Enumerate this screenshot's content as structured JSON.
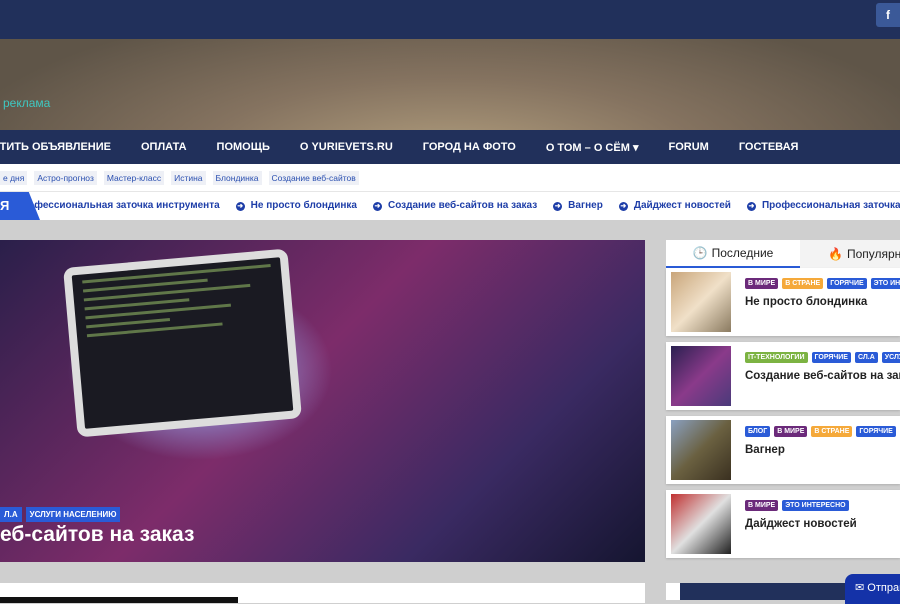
{
  "topbar": {
    "social": "f"
  },
  "header": {
    "ad_text": "реклама"
  },
  "nav": [
    "СТИТЬ ОБЪЯВЛЕНИЕ",
    "ОПЛАТА",
    "ПОМОЩЬ",
    "О YURIEVETS.RU",
    "ГОРОД НА ФОТО",
    "О ТОМ – О СЁМ ▾",
    "FORUM",
    "ГОСТЕВАЯ"
  ],
  "tags": [
    "е дня",
    "Астро-прогноз",
    "Мастер-класс",
    "Истина",
    "Блондинка",
    "Создание веб-сайтов"
  ],
  "ticker": {
    "label": "Я",
    "items": [
      "рофессиональная заточка инструмента",
      "Не просто блондинка",
      "Создание веб-сайтов на заказ",
      "Вагнер",
      "Дайджест новостей",
      "Профессиональная заточка инструмента"
    ]
  },
  "hero": {
    "cats": [
      "Л.А",
      "УСЛУГИ НАСЕЛЕНИЮ"
    ],
    "title": "еб-сайтов на заказ"
  },
  "sidebar": {
    "tabs": [
      "Последние",
      "Популярные"
    ],
    "posts": [
      {
        "cats": [
          [
            "В МИРЕ",
            "#6b2a7a"
          ],
          [
            "В СТРАНЕ",
            "#f5a93a"
          ],
          [
            "ГОРЯЧИЕ",
            "#2a5bd7"
          ],
          [
            "ЭТО ИНТЕРЕСНО",
            "#2a5bd7"
          ]
        ],
        "title": "Не просто блондинка"
      },
      {
        "cats": [
          [
            "IT-ТЕХНОЛОГИИ",
            "#7cb342"
          ],
          [
            "ГОРЯЧИЕ",
            "#2a5bd7"
          ],
          [
            "СЛ.А",
            "#2a5bd7"
          ],
          [
            "УСЛУГИ",
            "#2a5bd7"
          ]
        ],
        "title": "Создание веб-сайтов на заказ"
      },
      {
        "cats": [
          [
            "БЛОГ",
            "#2a5bd7"
          ],
          [
            "В МИРЕ",
            "#6b2a7a"
          ],
          [
            "В СТРАНЕ",
            "#f5a93a"
          ],
          [
            "ГОРЯЧИЕ",
            "#2a5bd7"
          ]
        ],
        "title": "Вагнер"
      },
      {
        "cats": [
          [
            "В МИРЕ",
            "#6b2a7a"
          ],
          [
            "ЭТО ИНТЕРЕСНО",
            "#2a5bd7"
          ]
        ],
        "title": "Дайджест новостей"
      }
    ]
  },
  "send_button": "Отправить"
}
